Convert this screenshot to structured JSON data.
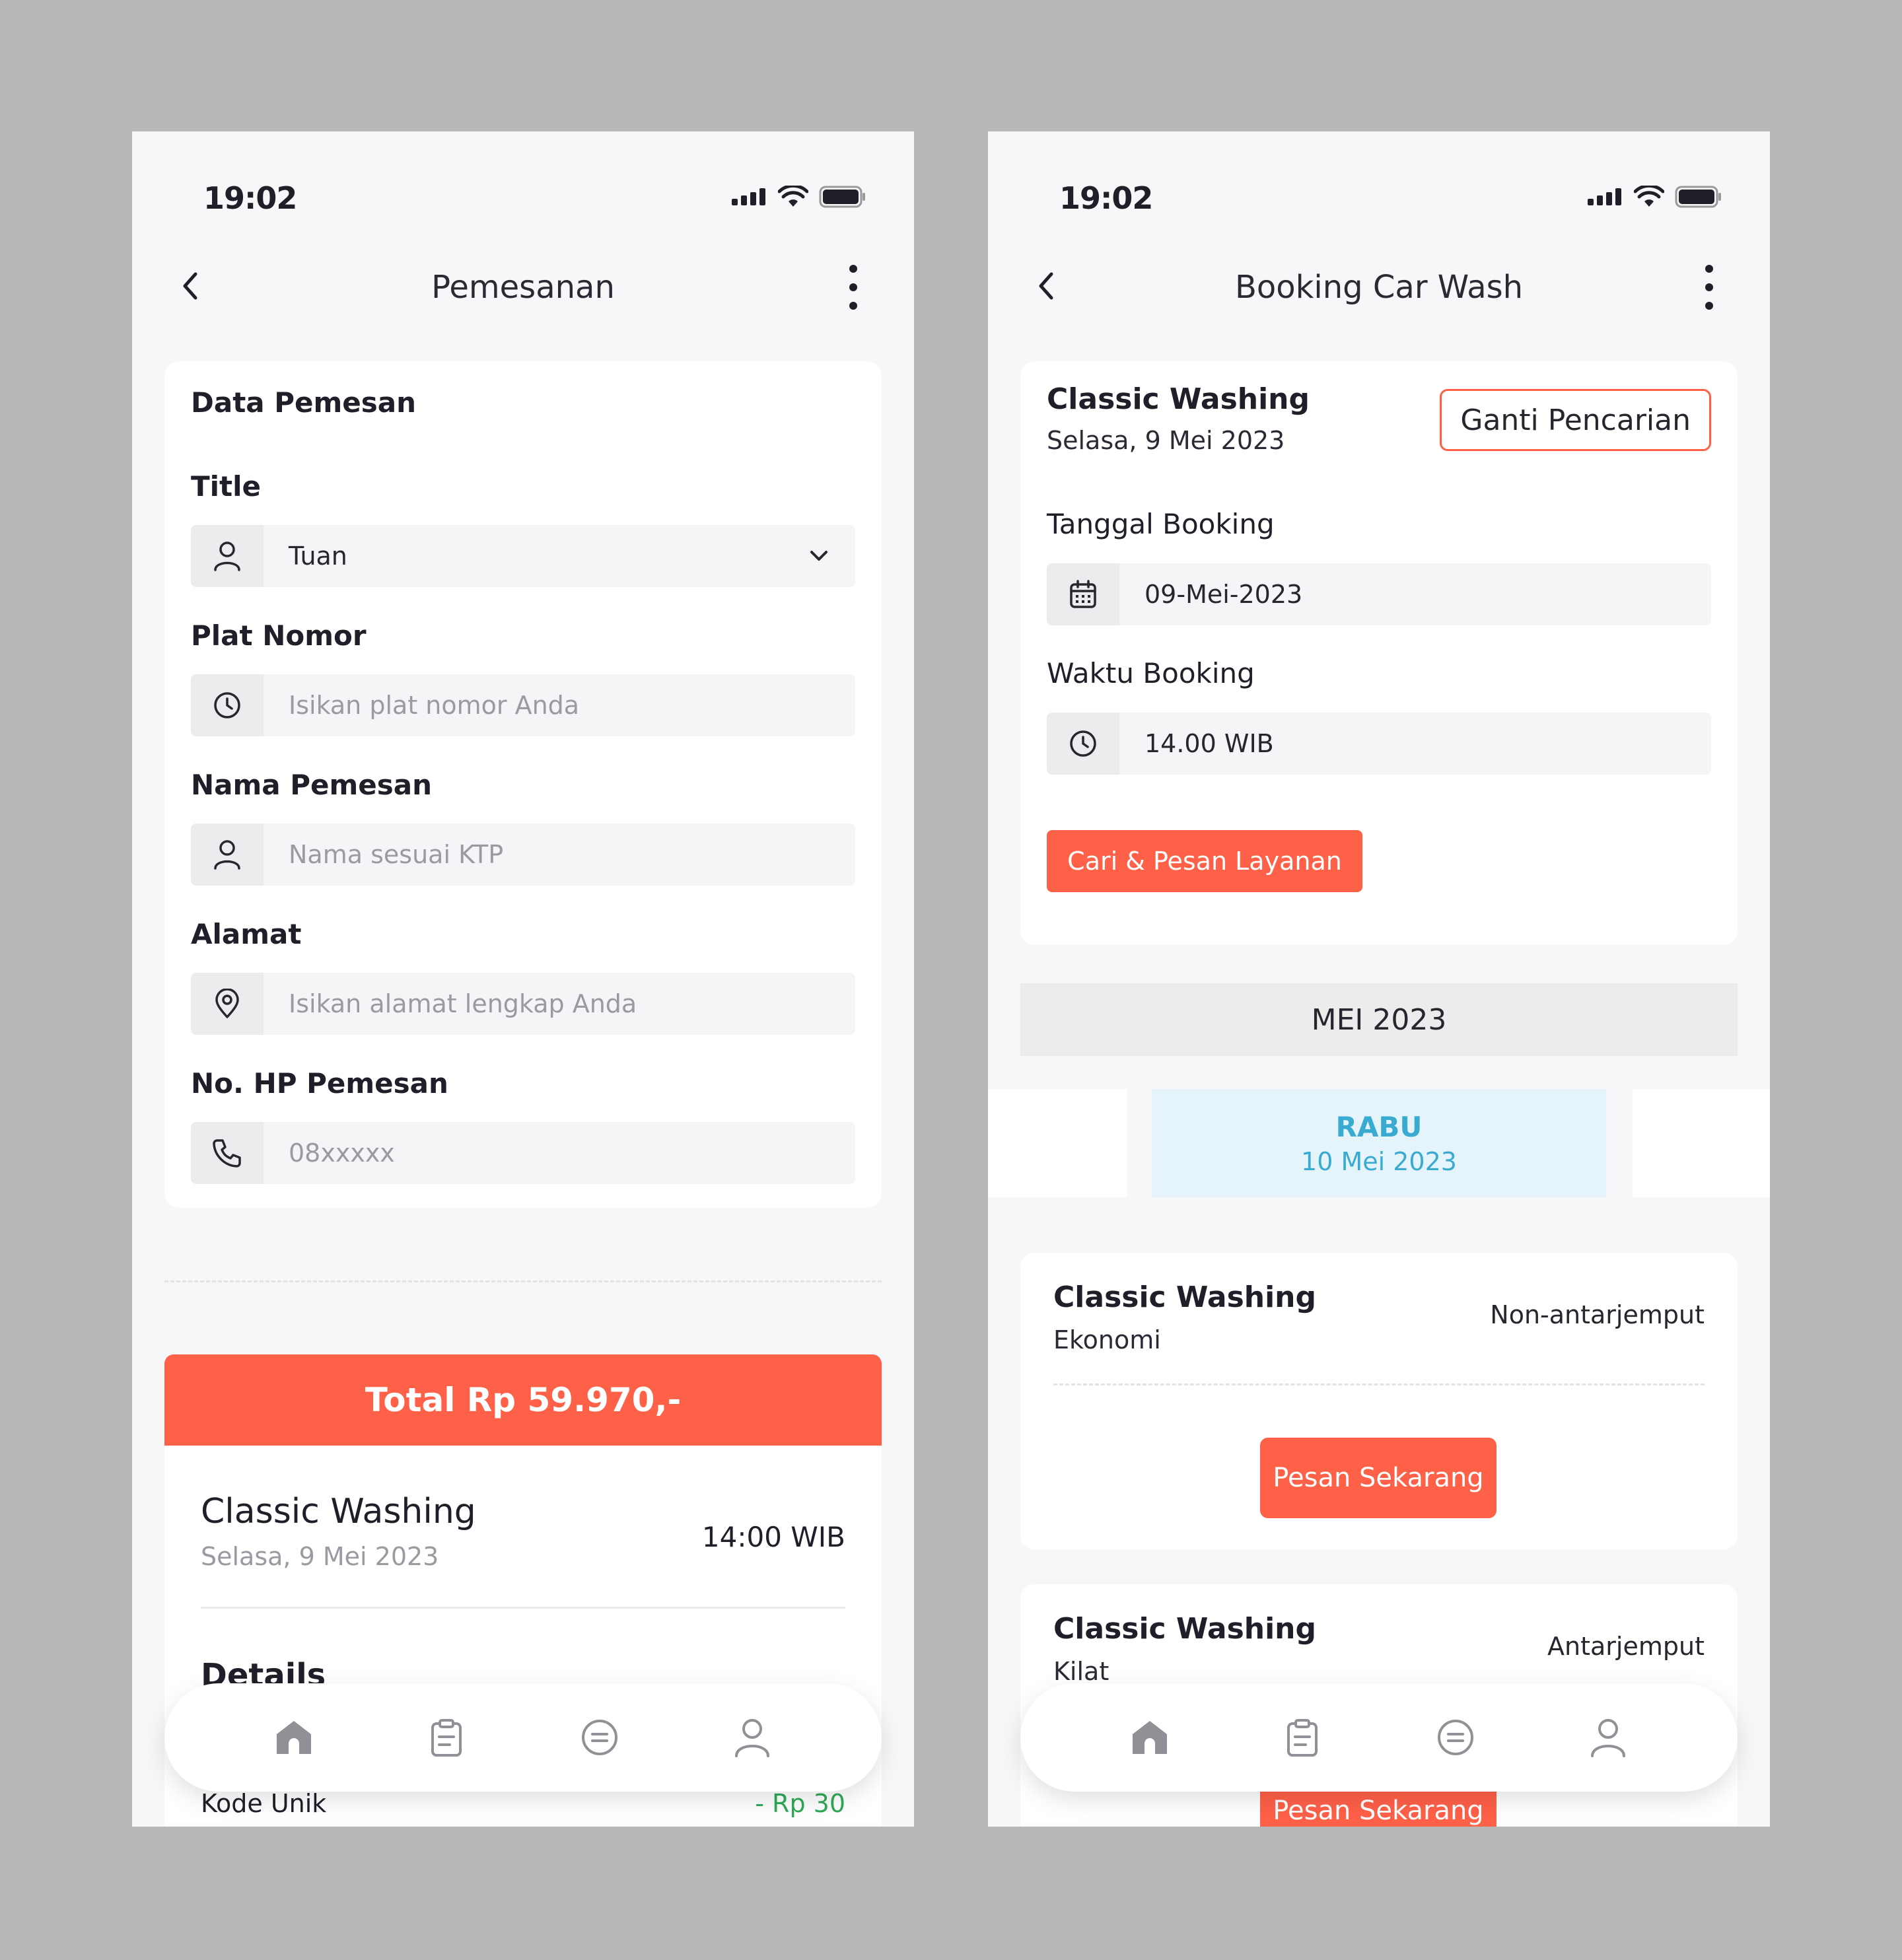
{
  "left": {
    "status": {
      "time": "19:02"
    },
    "nav": {
      "title": "Pemesanan"
    },
    "form": {
      "section_title": "Data Pemesan",
      "title_label": "Title",
      "title_value": "Tuan",
      "plat_label": "Plat Nomor",
      "plat_placeholder": "Isikan plat nomor Anda",
      "nama_label": "Nama Pemesan",
      "nama_placeholder": "Nama sesuai KTP",
      "alamat_label": "Alamat",
      "alamat_placeholder": "Isikan alamat lengkap Anda",
      "hp_label": "No. HP Pemesan",
      "hp_placeholder": "08xxxxx"
    },
    "total": "Total Rp 59.970,-",
    "summary": {
      "service": "Classic Washing",
      "date": "Selasa, 9 Mei 2023",
      "time": "14:00 WIB",
      "details": "Details",
      "kode_label": "Kode Unik",
      "kode_value": "- Rp 30"
    }
  },
  "right": {
    "status": {
      "time": "19:02"
    },
    "nav": {
      "title": "Booking Car Wash"
    },
    "search": {
      "service": "Classic Washing",
      "date": "Selasa, 9 Mei 2023",
      "change_button": "Ganti Pencarian",
      "tanggal_label": "Tanggal Booking",
      "tanggal_value": "09-Mei-2023",
      "waktu_label": "Waktu Booking",
      "waktu_value": "14.00 WIB",
      "search_button": "Cari & Pesan Layanan"
    },
    "month": "MEI 2023",
    "selected_day": {
      "name": "RABU",
      "date": "10 Mei 2023"
    },
    "services": [
      {
        "title": "Classic Washing",
        "sub": "Ekonomi",
        "type": "Non-antarjemput",
        "button": "Pesan Sekarang"
      },
      {
        "title": "Classic Washing",
        "sub": "Kilat",
        "type": "Antarjemput",
        "button": "Pesan Sekarang"
      }
    ]
  },
  "tabbar": {
    "icons": [
      "home-icon",
      "clipboard-icon",
      "chat-icon",
      "profile-icon"
    ]
  },
  "colors": {
    "accent": "#ff6048",
    "selected_day": "#39aad0",
    "success": "#2eaa58"
  }
}
